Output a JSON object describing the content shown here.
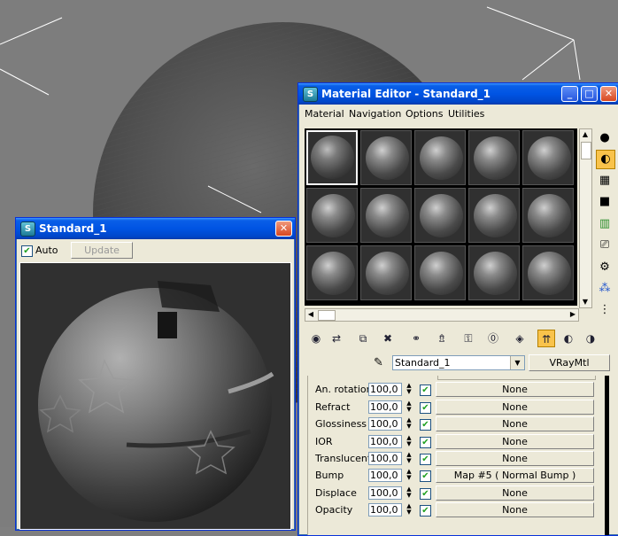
{
  "render_window": {
    "title": "Standard_1",
    "auto_label": "Auto",
    "auto_checked": true,
    "update_label": "Update"
  },
  "material_editor": {
    "title": "Material Editor - Standard_1",
    "menu": [
      "Material",
      "Navigation",
      "Options",
      "Utilities"
    ],
    "material_name": "Standard_1",
    "material_type": "VRayMtl",
    "maps": [
      {
        "label": "An. rotation",
        "amount": "100,0",
        "map": "None"
      },
      {
        "label": "Refract",
        "amount": "100,0",
        "map": "None"
      },
      {
        "label": "Glossiness",
        "amount": "100,0",
        "map": "None"
      },
      {
        "label": "IOR",
        "amount": "100,0",
        "map": "None"
      },
      {
        "label": "Translucent",
        "amount": "100,0",
        "map": "None"
      },
      {
        "label": "Bump",
        "amount": "100,0",
        "map": "Map #5  ( Normal Bump )"
      },
      {
        "label": "Displace",
        "amount": "100,0",
        "map": "None"
      },
      {
        "label": "Opacity",
        "amount": "100,0",
        "map": "None"
      }
    ]
  },
  "icons": {
    "app": "3dsmax-icon",
    "minimize": "minimize-icon",
    "maximize": "maximize-icon",
    "close": "close-icon"
  },
  "colors": {
    "title_bar": "#0054e3",
    "viewport_bg": "#7d7d7d",
    "window_bg": "#ece9d8"
  }
}
